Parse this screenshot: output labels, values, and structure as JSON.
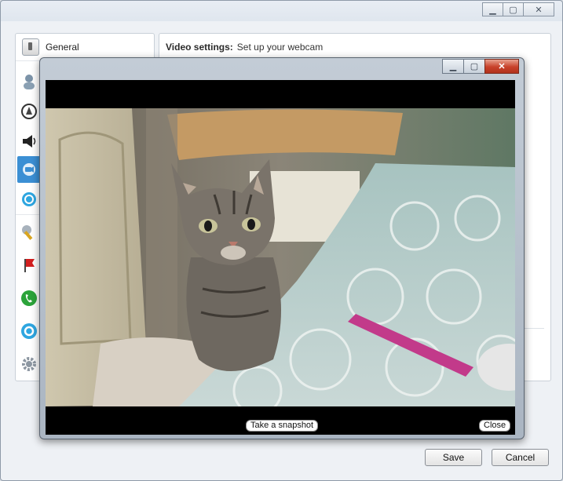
{
  "nav": {
    "header_label": "General",
    "items": [
      {
        "icon": "person-icon",
        "active": false
      },
      {
        "icon": "privacy-icon",
        "active": false
      },
      {
        "icon": "speaker-icon",
        "active": false
      },
      {
        "icon": "webcam-icon",
        "active": true
      },
      {
        "icon": "skype-icon",
        "active": false
      },
      {
        "icon": "wrench-icon",
        "active": false
      },
      {
        "icon": "flag-icon",
        "active": false
      },
      {
        "icon": "phone-icon",
        "active": false
      },
      {
        "icon": "help-icon",
        "active": false
      },
      {
        "icon": "gear-icon",
        "active": false
      }
    ]
  },
  "content": {
    "title": "Video settings:",
    "subtitle": "Set up your webcam"
  },
  "footer": {
    "save_label": "Save",
    "cancel_label": "Cancel"
  },
  "video_window": {
    "snapshot_label": "Take a snapshot",
    "close_label": "Close"
  },
  "colors": {
    "accent": "#3b8fd4",
    "close_button": "#c8412a"
  }
}
